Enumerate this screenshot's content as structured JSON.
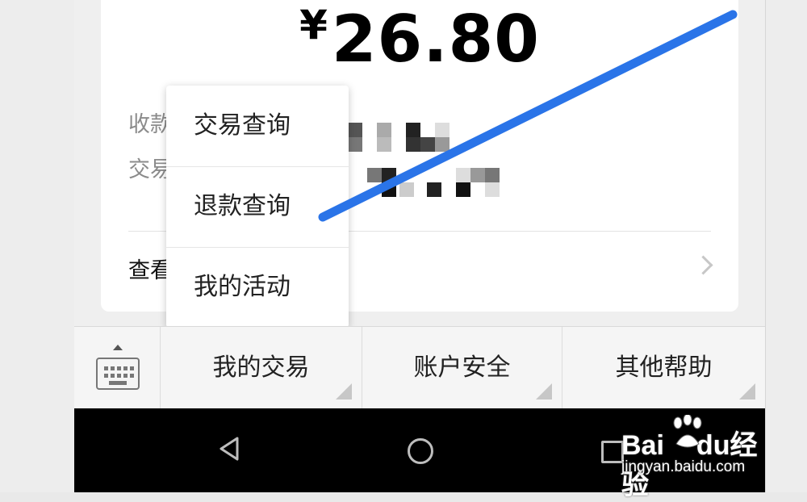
{
  "receipt": {
    "currency_symbol": "¥",
    "amount": "26.80",
    "payee_label": "收款",
    "transaction_label": "交易",
    "view_label": "查看"
  },
  "popup_menu": {
    "items": [
      {
        "label": "交易查询"
      },
      {
        "label": "退款查询"
      },
      {
        "label": "我的活动"
      }
    ]
  },
  "tab_bar": {
    "keyboard_icon": "keyboard-icon",
    "tabs": [
      {
        "label": "我的交易"
      },
      {
        "label": "账户安全"
      },
      {
        "label": "其他帮助"
      }
    ]
  },
  "nav_bar": {
    "back_icon": "back-triangle-icon",
    "home_icon": "home-circle-icon",
    "recent_icon": "recent-square-icon"
  },
  "watermark": {
    "logo": "Bai",
    "logo_tail": "du",
    "logo_cn": "经验",
    "url": "jingyan.baidu.com"
  },
  "colors": {
    "annotation_stroke": "#2a74e8",
    "nav_bar": "#000000",
    "card": "#ffffff"
  }
}
